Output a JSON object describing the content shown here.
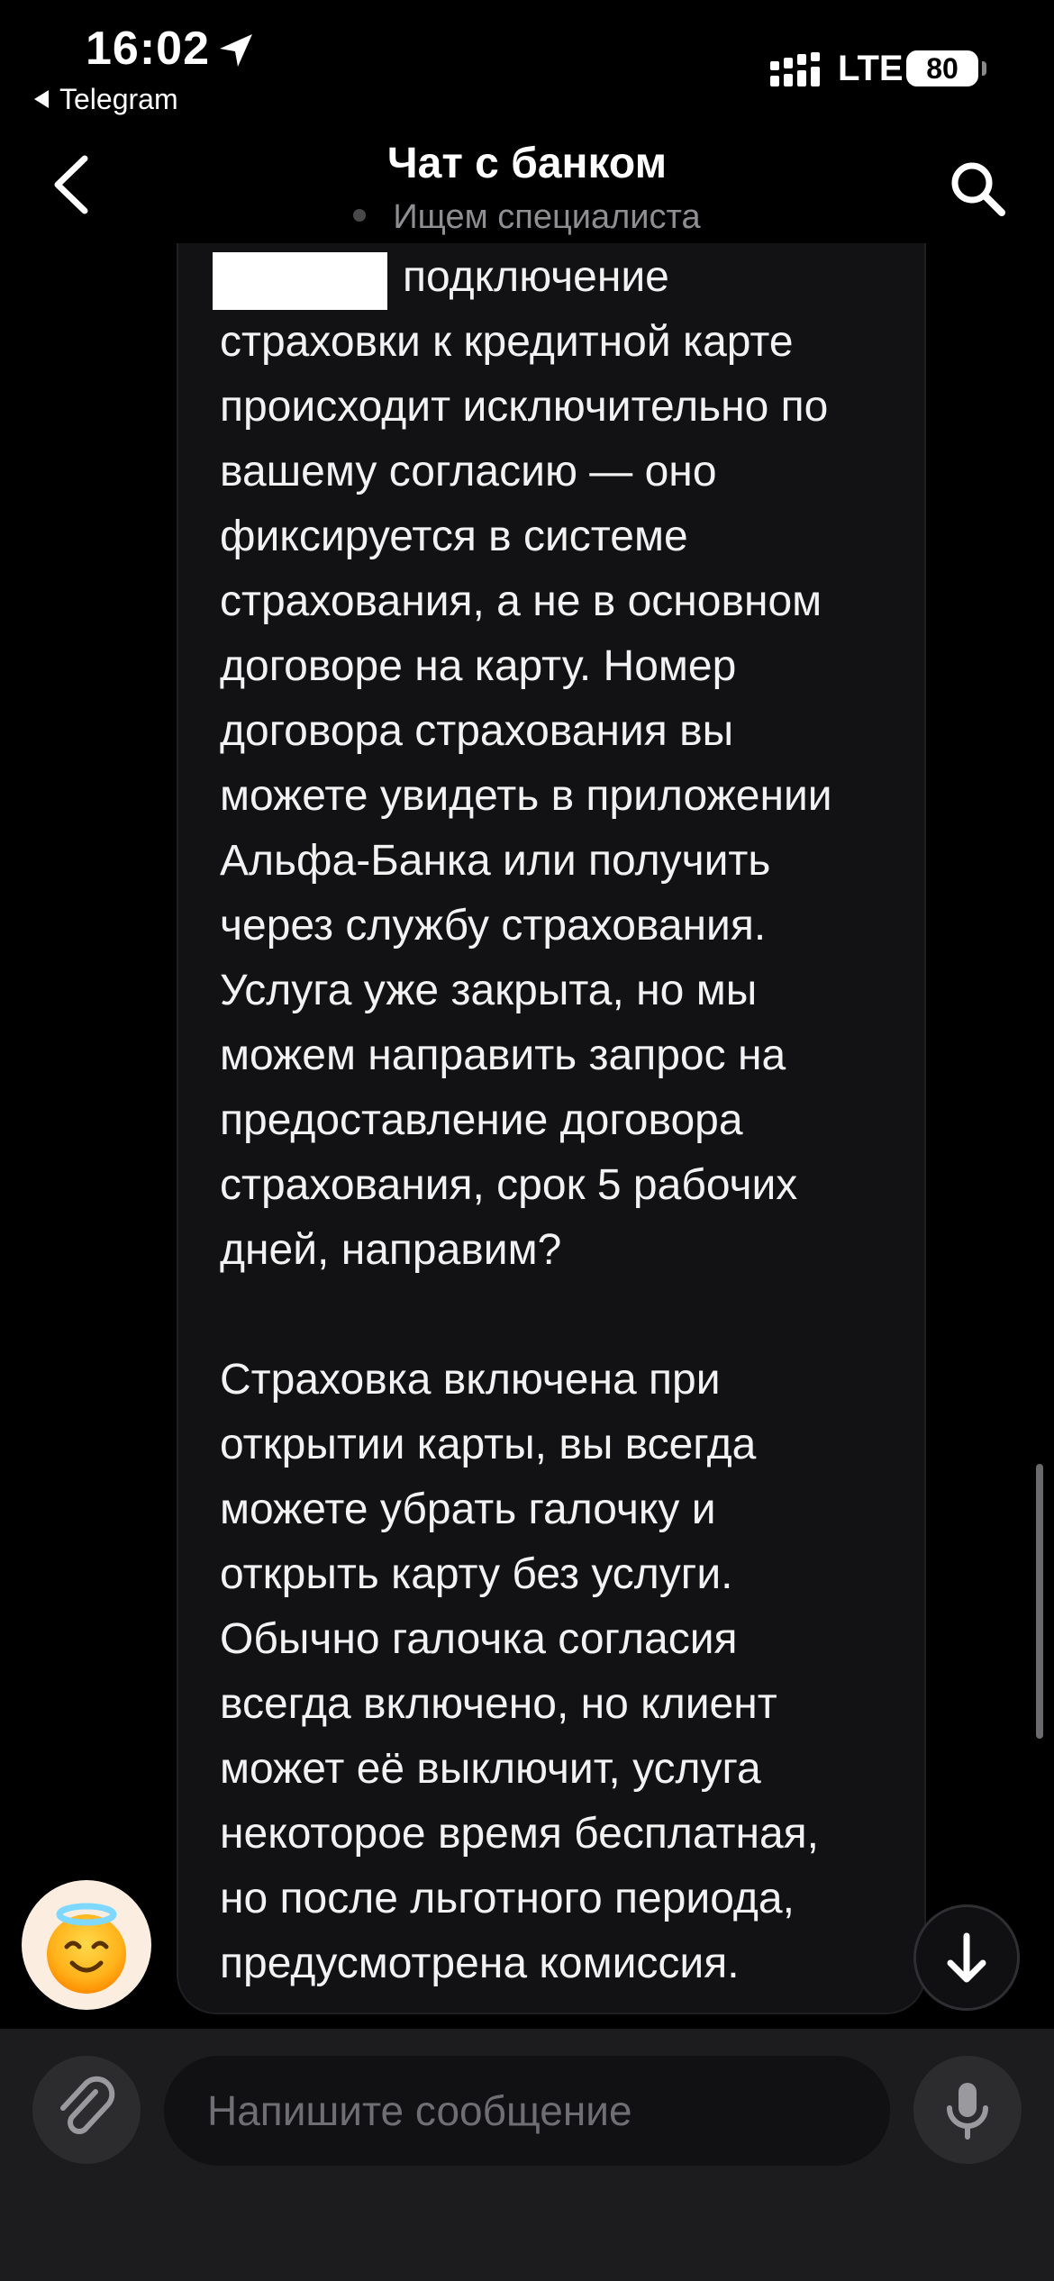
{
  "status_bar": {
    "time": "16:02",
    "back_app": "Telegram",
    "network": "LTE",
    "battery": "80"
  },
  "header": {
    "title": "Чат с банком",
    "status": "Ищем специалиста"
  },
  "message": {
    "first_line": "подключение",
    "body": "страховки к кредитной карте\nпроисходит исключительно по\nвашему согласию — оно\nфиксируется в системе\nстрахования, а не в основном\nдоговоре на карту. Номер\nдоговора страхования вы\nможете увидеть в приложении\nАльфа-Банка или получить\nчерез службу страхования.\nУслуга уже закрыта, но мы\nможем направить запрос на\nпредоставление договора\nстрахования, срок 5 рабочих\nдней, направим?\n\nСтраховка включена при\nоткрытии карты, вы всегда\nможете убрать галочку и\nоткрыть карту без услуги.\nОбычно галочка согласия\nвсегда включено, но клиент\nможет её выключит, услуга\nнекоторое время бесплатная,\nно после льготного периода,\nпредусмотрена комиссия."
  },
  "input": {
    "placeholder": "Напишите сообщение"
  },
  "icons": {
    "location": "location-arrow-icon",
    "signal": "cellular-signal-icon",
    "back": "chevron-left-icon",
    "search": "search-icon",
    "avatar": "angel-face-emoji-icon",
    "scroll_down": "arrow-down-icon",
    "attach": "paperclip-icon",
    "mic": "microphone-icon"
  },
  "colors": {
    "background": "#000000",
    "bubble": "#121214",
    "input_bar": "#1c1c1e",
    "secondary_text": "#8e8e93"
  }
}
